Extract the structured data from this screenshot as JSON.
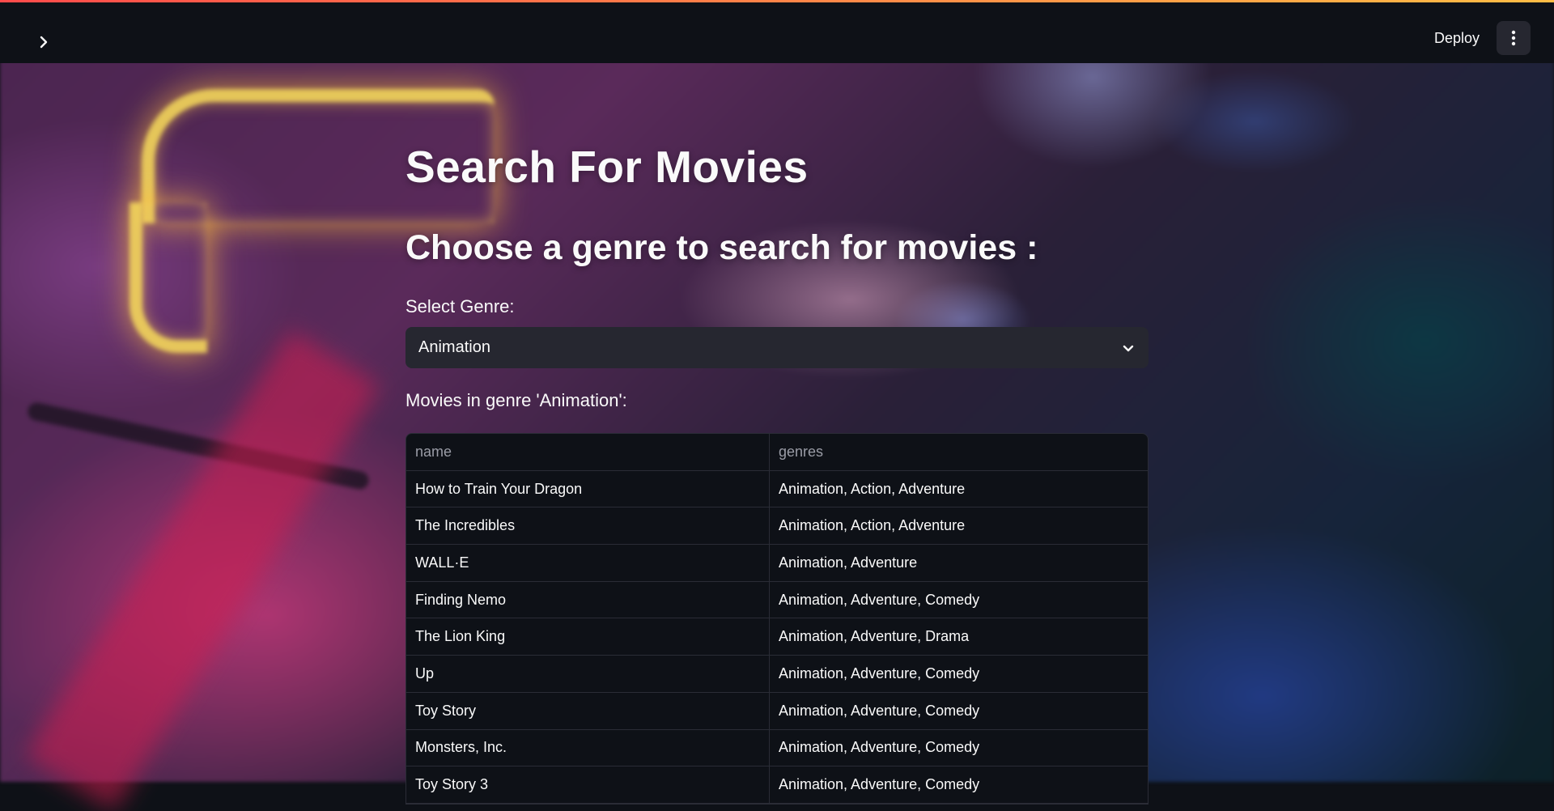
{
  "header": {
    "deploy_label": "Deploy"
  },
  "main": {
    "title": "Search For Movies",
    "subtitle": "Choose a genre to search for movies :",
    "select_label": "Select Genre:",
    "selected_genre": "Animation",
    "results_label": "Movies in genre 'Animation':"
  },
  "table": {
    "columns": [
      "name",
      "genres"
    ],
    "rows": [
      [
        "How to Train Your Dragon",
        "Animation, Action, Adventure"
      ],
      [
        "The Incredibles",
        "Animation, Action, Adventure"
      ],
      [
        "WALL·E",
        "Animation, Adventure"
      ],
      [
        "Finding Nemo",
        "Animation, Adventure, Comedy"
      ],
      [
        "The Lion King",
        "Animation, Adventure, Drama"
      ],
      [
        "Up",
        "Animation, Adventure, Comedy"
      ],
      [
        "Toy Story",
        "Animation, Adventure, Comedy"
      ],
      [
        "Monsters, Inc.",
        "Animation, Adventure, Comedy"
      ],
      [
        "Toy Story 3",
        "Animation, Adventure, Comedy"
      ]
    ]
  },
  "colors": {
    "app_background": "#0e1117",
    "widget_background": "#262730",
    "decoration_start": "#ff4b4b",
    "decoration_end": "#ffbd45"
  },
  "icons": {
    "sidebar_toggle": "chevron-right-icon",
    "menu": "more-vertical-icon",
    "select": "chevron-down-icon"
  }
}
